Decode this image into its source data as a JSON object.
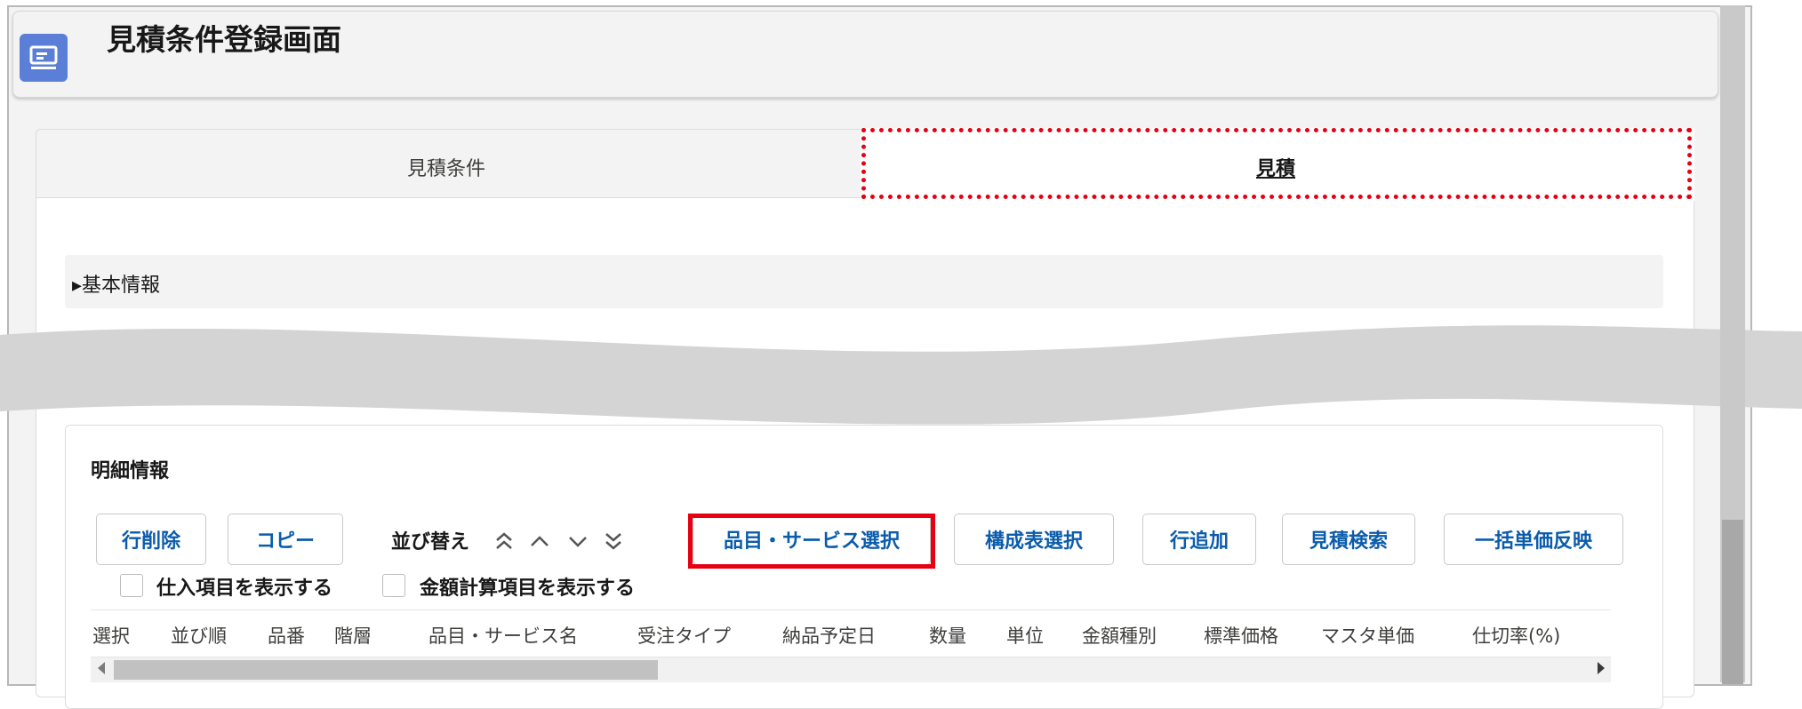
{
  "header": {
    "title": "見積条件登録画面",
    "icon": "quote-document-icon"
  },
  "tabs": [
    {
      "label": "見積条件",
      "active": false
    },
    {
      "label": "見積",
      "active": true
    }
  ],
  "sections": {
    "basic_info": "▸基本情報"
  },
  "details": {
    "title": "明細情報",
    "buttons": {
      "delete_row": "行削除",
      "copy": "コピー",
      "select_item_service": "品目・サービス選択",
      "select_bom": "構成表選択",
      "add_row": "行追加",
      "search_quote": "見積検索",
      "bulk_price": "一括単価反映"
    },
    "sort_label": "並び替え",
    "sort_icons": [
      "double-chevron-up-icon",
      "chevron-up-icon",
      "chevron-down-icon",
      "double-chevron-down-icon"
    ],
    "checkboxes": {
      "show_purchase": "仕入項目を表示する",
      "show_amount_calc": "金額計算項目を表示する"
    },
    "columns": [
      "選択",
      "並び順",
      "品番",
      "階層",
      "品目・サービス名",
      "受注タイプ",
      "納品予定日",
      "数量",
      "単位",
      "金額種別",
      "標準価格",
      "マスタ単価",
      "仕切率(%)"
    ]
  },
  "colors": {
    "accent": "#0b5cab",
    "highlight": "#e60012",
    "icon_bg": "#5b7fd6"
  }
}
